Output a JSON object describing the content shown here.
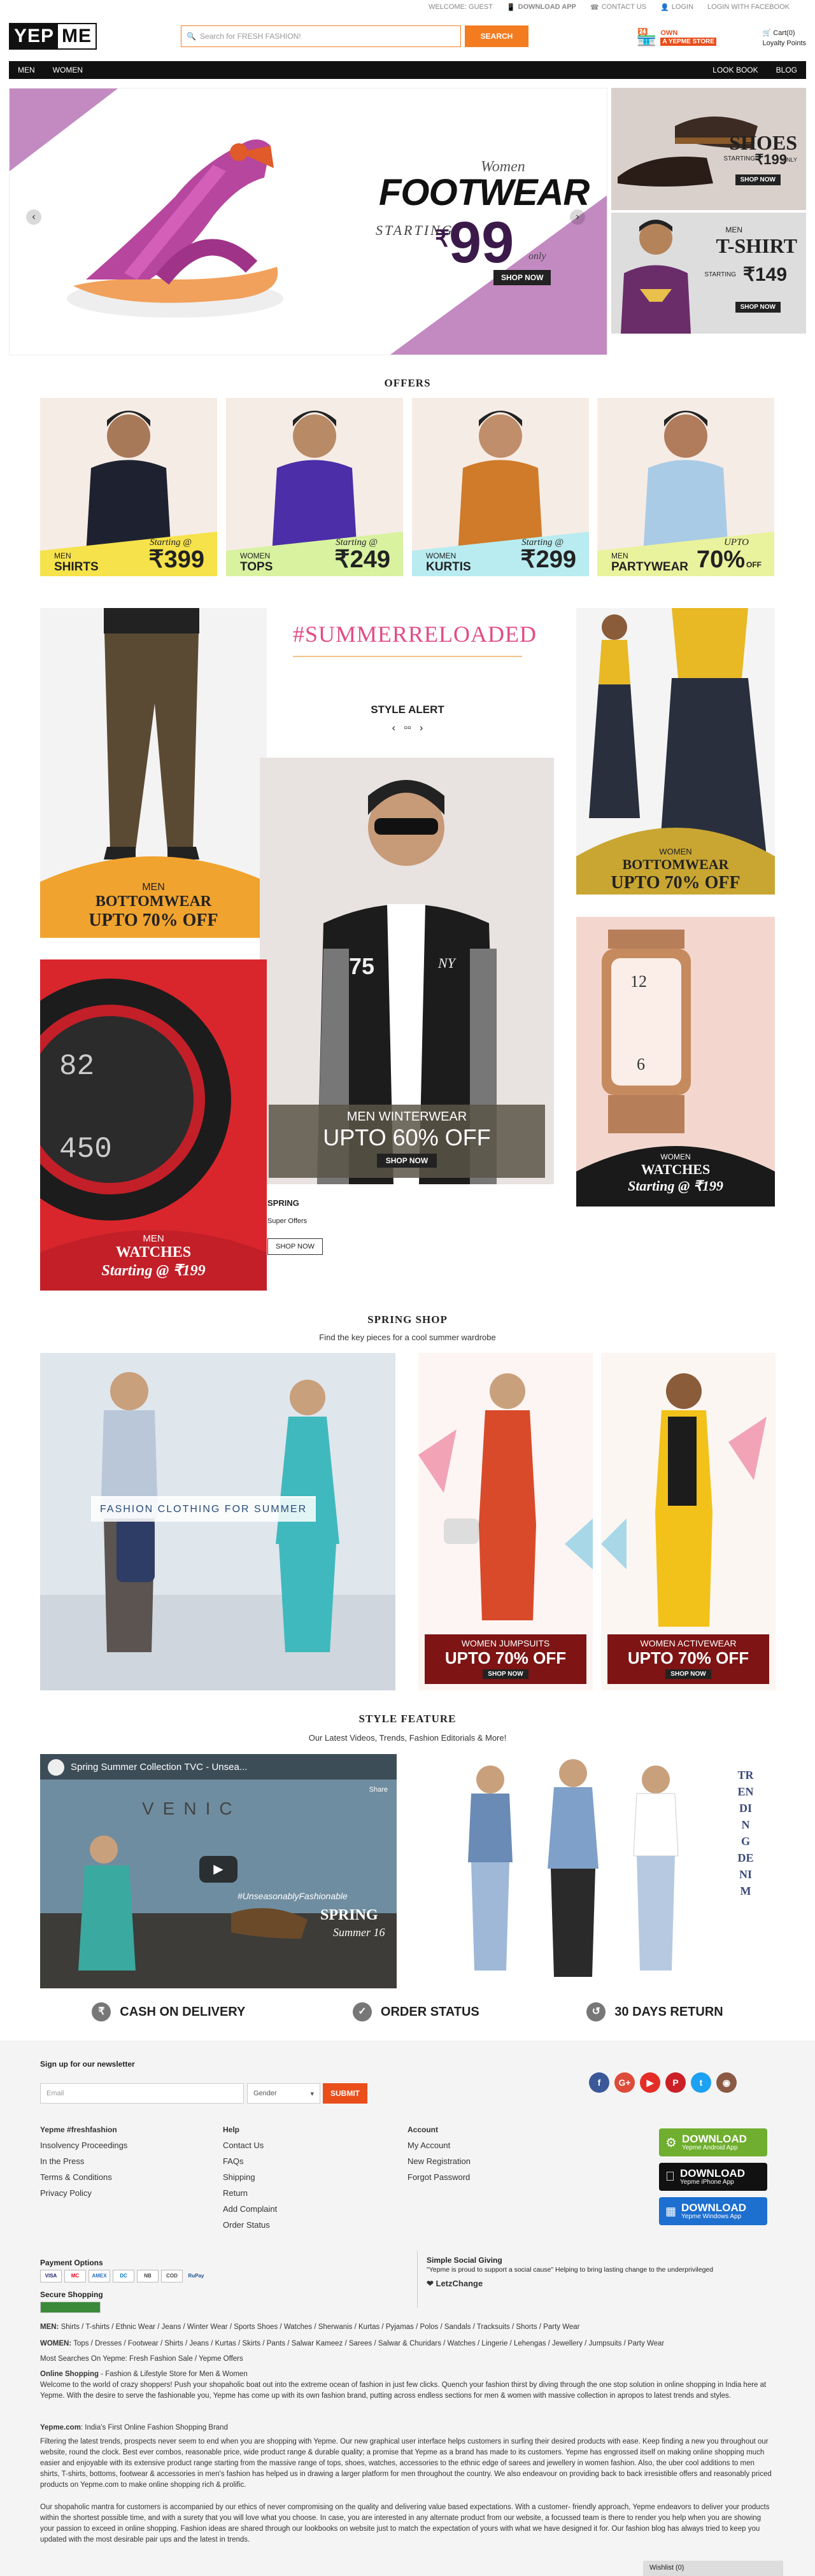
{
  "utility": {
    "welcome": "WELCOME: GUEST",
    "download": "DOWNLOAD APP",
    "contact": "CONTACT US",
    "login": "LOGIN",
    "facebook": "LOGIN WITH FACEBOOK"
  },
  "header": {
    "logo_a": "YEP",
    "logo_b": "ME",
    "search_placeholder": "Search for FRESH FASHION!",
    "search_button": "SEARCH",
    "store_own": "OWN",
    "store_tag": "A YEPME STORE",
    "cart": "Cart(0)",
    "loyalty": "Loyalty Points"
  },
  "nav": {
    "men": "MEN",
    "women": "WOMEN",
    "lookbook": "LOOK BOOK",
    "blog": "BLOG"
  },
  "hero": {
    "women": "Women",
    "footwear": "FOOTWEAR",
    "starting": "STARTING",
    "rupee": "₹",
    "price": "99",
    "only": "only",
    "shop": "SHOP NOW",
    "prev": "‹",
    "next": "›"
  },
  "side_banners": {
    "shoes_title": "SHOES",
    "shoes_starting": "STARTING",
    "shoes_price": "₹199",
    "shoes_only": "ONLY",
    "shoes_shop": "SHOP NOW",
    "tshirt_men": "MEN",
    "tshirt_title": "T-SHIRT",
    "tshirt_starting": "STARTING",
    "tshirt_price": "₹149",
    "tshirt_shop": "SHOP NOW"
  },
  "offers": {
    "title": "OFFERS",
    "items": [
      {
        "gender": "MEN",
        "cat": "SHIRTS",
        "lead": "Starting @",
        "price": "₹399",
        "band": "#f6e24a"
      },
      {
        "gender": "WOMEN",
        "cat": "TOPS",
        "lead": "Starting @",
        "price": "₹249",
        "band": "#d8f2a0"
      },
      {
        "gender": "WOMEN",
        "cat": "KURTIS",
        "lead": "Starting @",
        "price": "₹299",
        "band": "#b9ecf0"
      },
      {
        "gender": "MEN",
        "cat": "PARTYWEAR",
        "lead": "UPTO",
        "price": "70%",
        "sub": "OFF",
        "band": "#e9f29c"
      }
    ]
  },
  "style_alert": {
    "hashtag": "#SUMMERRELOADED",
    "title": "STYLE ALERT",
    "controls": "‹   ▫▫   ›",
    "bottomwear_g": "MEN",
    "bottomwear_t": "BOTTOMWEAR",
    "bottomwear_o": "UPTO 70% OFF",
    "winter_t": "MEN WINTERWEAR",
    "winter_o": "UPTO 60% OFF",
    "winter_shop": "SHOP NOW",
    "wbottom_g": "WOMEN",
    "wbottom_t": "BOTTOMWEAR",
    "wbottom_o": "UPTO 70% OFF",
    "watch_g": "MEN",
    "watch_t": "WATCHES",
    "watch_p": "Starting @ ₹199",
    "wwatch_g": "WOMEN",
    "wwatch_t": "WATCHES",
    "wwatch_p": "Starting @ ₹199",
    "spring_title": "SPRING",
    "spring_sub": "Super Offers",
    "spring_btn": "SHOP NOW"
  },
  "spring_shop": {
    "title": "SPRING SHOP",
    "subtitle": "Find the key pieces for a cool summer wardrobe",
    "banner": "FASHION CLOTHING FOR SUMMER",
    "c1_a": "WOMEN JUMPSUITS",
    "c1_b": "UPTO 70% OFF",
    "c1_shop": "SHOP NOW",
    "c2_a": "WOMEN ACTIVEWEAR",
    "c2_b": "UPTO 70% OFF",
    "c2_shop": "SHOP NOW"
  },
  "style_feature": {
    "title": "STYLE FEATURE",
    "subtitle": "Our Latest Videos, Trends, Fashion Editorials & More!",
    "video_title": "Spring Summer Collection TVC - Unsea...",
    "video_share": "Share",
    "video_tag": "#UnseasonablyFashionable",
    "video_spring": "SPRING",
    "video_summer": "Summer 16",
    "trend": "TRENDING DENIM"
  },
  "services": {
    "cod": "CASH ON DELIVERY",
    "order": "ORDER STATUS",
    "ret": "30 DAYS RETURN"
  },
  "footer": {
    "signup": "Sign up for our newsletter",
    "email_ph": "Email",
    "gender": "Gender",
    "submit": "SUBMIT",
    "col1_title": "Yepme #freshfashion",
    "col1": [
      "Insolvency Proceedings",
      "In the Press",
      "Terms & Conditions",
      "Privacy Policy"
    ],
    "col2_title": "Help",
    "col2": [
      "Contact Us",
      "FAQs",
      "Shipping",
      "Return",
      "Add Complaint",
      "Order Status"
    ],
    "col3_title": "Account",
    "col3": [
      "My Account",
      "New Registration",
      "Forgot Password"
    ],
    "app1_a": "DOWNLOAD",
    "app1_b": "Yepme Android App",
    "app2_a": "DOWNLOAD",
    "app2_b": "Yepme iPhone App",
    "app3_a": "DOWNLOAD",
    "app3_b": "Yepme Windows App",
    "payment": "Payment Options",
    "secure": "Secure Shopping",
    "giving": "Simple Social Giving",
    "giving_txt": "\"Yepme is proud to support a social cause\" Helping to bring lasting change to the underprivileged",
    "letz": "LetzChange",
    "men_label": "MEN:",
    "men_links": "Shirts / T-shirts / Ethnic Wear / Jeans / Winter Wear / Sports Shoes / Watches / Sherwanis / Kurtas / Pyjamas / Polos / Sandals / Tracksuits / Shorts / Party Wear",
    "women_label": "WOMEN:",
    "women_links": "Tops / Dresses / Footwear / Shirts / Jeans / Kurtas / Skirts / Pants / Salwar Kameez / Sarees / Salwar & Churidars / Watches / Lingerie / Lehengas / Jewellery / Jumpsuits / Party Wear",
    "most": "Most Searches On Yepme: Fresh Fashion Sale / Yepme Offers",
    "online_t": "Online Shopping",
    "online_s": " - Fashion & Lifestyle Store for Men & Women",
    "p1": "Welcome to the world of crazy shoppers! Push your shopaholic boat out into the extreme ocean of fashion in just few clicks. Quench your fashion thirst by diving through the one stop solution in online shopping in India here at Yepme. With the desire to serve the fashionable you, Yepme has come up with its own fashion brand, putting across endless sections for men & women with massive collection in apropos to latest trends and styles.",
    "brand_t": "Yepme.com",
    "brand_s": ": India's First Online Fashion Shopping Brand",
    "p2": "Filtering the latest trends, prospects never seem to end when you are shopping with Yepme. Our new graphical user interface helps customers in surfing their desired products with ease. Keep finding a new you throughout our website, round the clock. Best ever combos, reasonable price, wide product range & durable quality; a promise that Yepme as a brand has made to its customers. Yepme has engrossed itself on making online shopping much easier and enjoyable with its extensive product range starting from the massive range of tops, shoes, watches, accessories to the ethnic edge of sarees and jewellery in women fashion. Also, the uber cool additions to men shirts, T-shirts, bottoms, footwear & accessories in men's fashion has helped us in drawing a larger platform for men throughout the country. We also endeavour on providing back to back irresistible offers and reasonably priced products on Yepme.com to make online shopping rich & prolific.",
    "p3": "Our shopaholic mantra for customers is accompanied by our ethics of never compromising on the quality and delivering value based expectations. With a customer- friendly approach, Yepme endeavors to deliver your products within the shortest possible time, and with a surety that you will love what you choose. In case, you are interested in any alternate product from our website, a focussed team is there to render you help when you are showing your passion to exceed in online shopping. Fashion ideas are shared through our lookbooks on website just to match the expectation of yours with what we have designed it for. Our fashion blog has always tried to keep you updated with the most desirable pair ups and the latest in trends.",
    "wishlist": "Wishlist (0)"
  }
}
